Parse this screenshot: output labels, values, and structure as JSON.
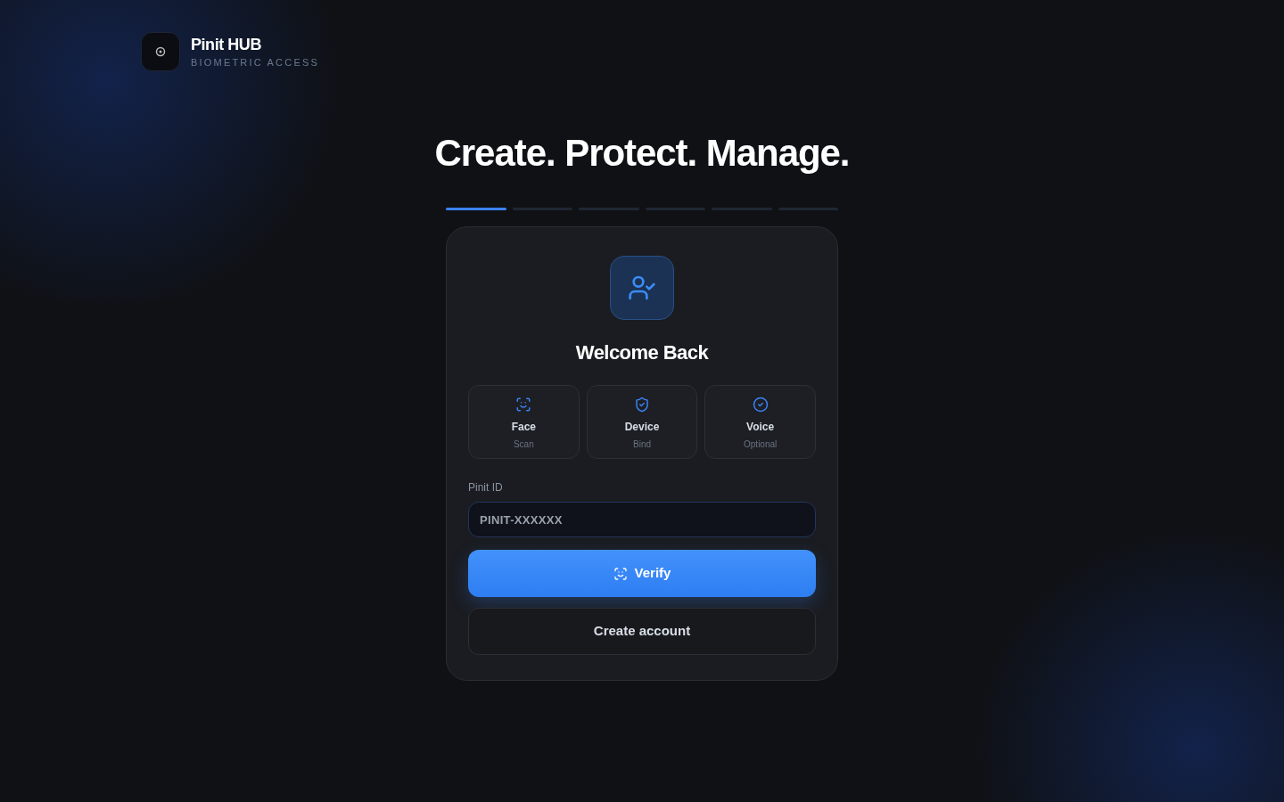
{
  "brand": {
    "name": "Pinit HUB",
    "tagline": "BIOMETRIC ACCESS"
  },
  "headline": "Create. Protect. Manage.",
  "steps": [
    {
      "selected": true
    },
    {
      "selected": false
    },
    {
      "selected": false
    },
    {
      "selected": false
    },
    {
      "selected": false
    },
    {
      "selected": false
    }
  ],
  "card": {
    "title": "Welcome Back",
    "methods": [
      {
        "kind": "face",
        "title": "Face",
        "subtitle": "Scan"
      },
      {
        "kind": "device",
        "title": "Device",
        "subtitle": "Bind"
      },
      {
        "kind": "voice",
        "title": "Voice",
        "subtitle": "Optional"
      }
    ],
    "field": {
      "label": "Pinit ID",
      "placeholder": "PINIT-XXXXXX"
    },
    "primary_button": "Verify",
    "secondary_button": "Create account"
  }
}
